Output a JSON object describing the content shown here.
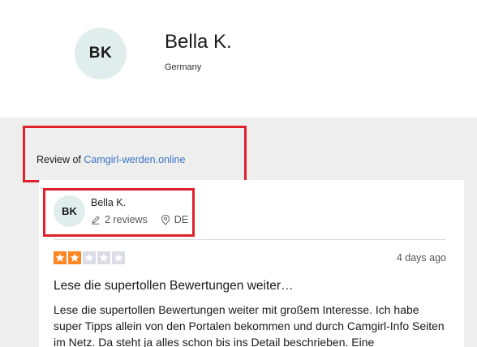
{
  "profile": {
    "initials": "BK",
    "name": "Bella K.",
    "country": "Germany"
  },
  "review_of": {
    "prefix": "Review of",
    "company": "Camgirl-werden.online"
  },
  "reviewer": {
    "initials": "BK",
    "name": "Bella K.",
    "reviews_count": "2 reviews",
    "country_code": "DE"
  },
  "review": {
    "rating": 2,
    "max_rating": 5,
    "star_color": "#ff8622",
    "empty_star_color": "#dcdce6",
    "date": "4 days ago",
    "title": "Lese die supertollen Bewertungen weiter…",
    "body": "Lese die supertollen Bewertungen weiter mit großem Interesse. Ich habe super Tipps allein von den Portalen bekommen und durch Camgirl-Info Seiten im Netz. Da steht ja alles schon bis ins Detail beschrieben. Eine"
  },
  "colors": {
    "highlight_border": "#e0202a",
    "link": "#3a73c4",
    "avatar_bg": "#dfeeec",
    "page_bg": "#eeeeee"
  }
}
